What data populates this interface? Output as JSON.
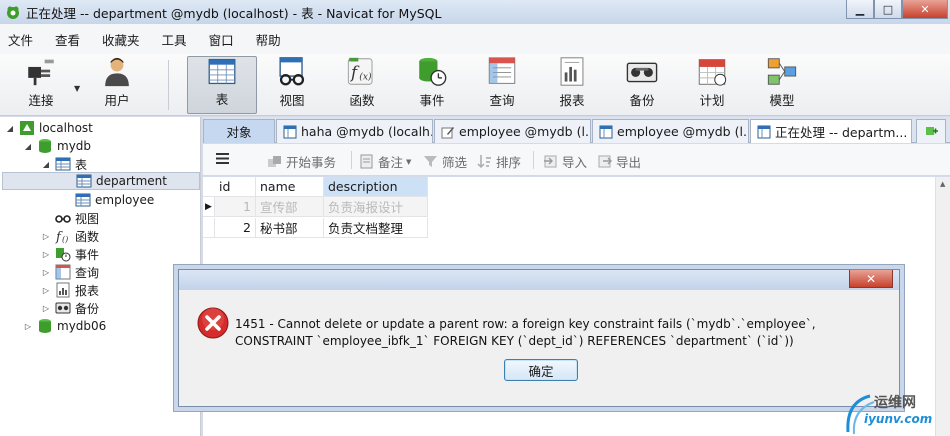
{
  "window": {
    "title": "正在处理 -- department @mydb (localhost) - 表 - Navicat for MySQL",
    "min_glyph": "▁",
    "max_glyph": "□",
    "close_glyph": "✕"
  },
  "menu": [
    "文件",
    "查看",
    "收藏夹",
    "工具",
    "窗口",
    "帮助"
  ],
  "toolbar": {
    "connect": "连接",
    "user": "用户",
    "table": "表",
    "view": "视图",
    "function": "函数",
    "event": "事件",
    "query": "查询",
    "report": "报表",
    "backup": "备份",
    "schedule": "计划",
    "model": "模型"
  },
  "tree": {
    "localhost": "localhost",
    "mydb": "mydb",
    "tables": "表",
    "department": "department",
    "employee": "employee",
    "views": "视图",
    "functions": "函数",
    "events": "事件",
    "queries": "查询",
    "reports": "报表",
    "backups": "备份",
    "mydb06": "mydb06"
  },
  "tabs": {
    "objects": "对象",
    "t1": "haha @mydb (localh...",
    "t2": "employee @mydb (l...",
    "t3": "employee @mydb (l...",
    "t4": "正在处理 -- departm..."
  },
  "subtoolbar": {
    "begin": "开始事务",
    "note": "备注",
    "filter": "筛选",
    "sort": "排序",
    "import": "导入",
    "export": "导出"
  },
  "grid": {
    "headers": [
      "id",
      "name",
      "description"
    ],
    "rows": [
      [
        "1",
        "宣传部",
        "负责海报设计"
      ],
      [
        "2",
        "秘书部",
        "负责文档整理"
      ]
    ],
    "row_marker": "▶"
  },
  "dialog": {
    "close_glyph": "✕",
    "message": "1451 - Cannot delete or update a parent row: a foreign key constraint fails (`mydb`.`employee`, CONSTRAINT `employee_ibfk_1` FOREIGN KEY (`dept_id`) REFERENCES `department` (`id`))",
    "ok_label": "确定"
  },
  "watermark": {
    "line1": "运维网",
    "line2": "iyunv.com"
  },
  "colors": {
    "selected_header": "#cce0f6",
    "error_red": "#d42c2c"
  }
}
